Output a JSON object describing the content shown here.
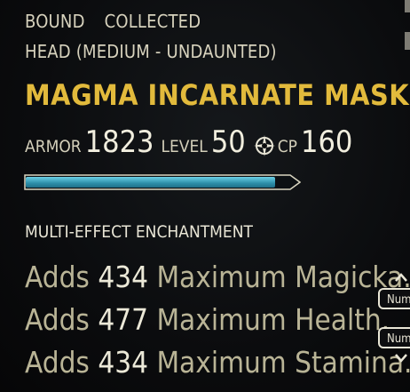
{
  "item": {
    "status": [
      "BOUND",
      "COLLECTED"
    ],
    "slot": "HEAD (MEDIUM - UNDAUNTED)",
    "name": "MAGMA INCARNATE MASK",
    "armor_label": "ARMOR",
    "armor_value": "1823",
    "level_label": "LEVEL",
    "level_value": "50",
    "cp_label": "CP",
    "cp_value": "160",
    "condition_fill": 0.95,
    "enchant_header": "MULTI-EFFECT ENCHANTMENT",
    "effects": [
      {
        "pre": "Adds",
        "num": "434",
        "post": "Maximum Magicka."
      },
      {
        "pre": "Adds",
        "num": "477",
        "post": "Maximum Health."
      },
      {
        "pre": "Adds",
        "num": "434",
        "post": "Maximum Stamina."
      }
    ]
  },
  "key_hints": [
    {
      "label": "Num",
      "icon": "chevron-up-icon"
    },
    {
      "label": "Num",
      "icon": "chevron-down-icon"
    }
  ],
  "colors": {
    "title": "#e2ba3c",
    "bar": "#4fb7d2",
    "text": "#cfcbb6"
  }
}
